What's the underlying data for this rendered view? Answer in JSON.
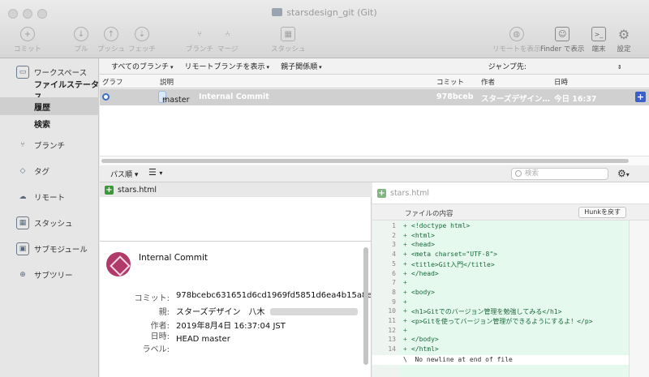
{
  "window": {
    "title": "starsdesign_git (Git)"
  },
  "toolbar": {
    "left": [
      {
        "label": "コミット",
        "icon": "plus-icon",
        "glyph": "+"
      },
      {
        "label": "プル",
        "icon": "arrow-down-icon",
        "glyph": "↓"
      },
      {
        "label": "プッシュ",
        "icon": "arrow-up-icon",
        "glyph": "↑"
      },
      {
        "label": "フェッチ",
        "icon": "fetch-icon",
        "glyph": "⇣"
      },
      {
        "label": "ブランチ",
        "icon": "branch-icon",
        "glyph": "⑂"
      },
      {
        "label": "マージ",
        "icon": "merge-icon",
        "glyph": "⑃"
      },
      {
        "label": "スタッシュ",
        "icon": "stash-icon",
        "glyph": "▦"
      }
    ],
    "right": [
      {
        "label": "リモートを表示",
        "icon": "globe-icon",
        "glyph": "◍"
      },
      {
        "label": "Finder で表示",
        "icon": "finder-icon",
        "glyph": "☺"
      },
      {
        "label": "端末",
        "icon": "terminal-icon",
        "glyph": ">_"
      },
      {
        "label": "設定",
        "icon": "gear-icon",
        "glyph": "⚙"
      }
    ]
  },
  "sidebar": {
    "workspace": "ワークスペース",
    "sub": [
      "ファイルステータス",
      "履歴",
      "検索"
    ],
    "items": [
      {
        "label": "ブランチ",
        "icon": "branch-icon",
        "glyph": "⑂"
      },
      {
        "label": "タグ",
        "icon": "tag-icon",
        "glyph": "◇"
      },
      {
        "label": "リモート",
        "icon": "cloud-icon",
        "glyph": "☁"
      },
      {
        "label": "スタッシュ",
        "icon": "stash-icon",
        "glyph": "▦"
      },
      {
        "label": "サブモジュール",
        "icon": "submodule-icon",
        "glyph": "▣"
      },
      {
        "label": "サブツリー",
        "icon": "subtree-icon",
        "glyph": "⊕"
      }
    ]
  },
  "filters": {
    "all_branches": "すべてのブランチ",
    "show_remote": "リモートブランチを表示",
    "ancestor_order": "親子関係順",
    "jump_to": "ジャンプ先:"
  },
  "columns": {
    "graph": "グラフ",
    "description": "説明",
    "commit": "コミット",
    "author": "作者",
    "date": "日時"
  },
  "commit_row": {
    "branch": "master",
    "message": "Internal Commit",
    "hash": "978bceb",
    "author": "スターズデザイン…",
    "date": "今日 16:37"
  },
  "bottom_bar": {
    "path_sort": "パス順",
    "search_placeholder": "検索"
  },
  "files": [
    {
      "name": "stars.html"
    }
  ],
  "details": {
    "message": "Internal Commit",
    "labels": {
      "commit": "コミット:",
      "parent": "親:",
      "author": "作者:",
      "date": "日時:",
      "label": "ラベル:"
    },
    "commit": "978bcebc631651d6cd1969fd5851d6ea4b15a8e6 |",
    "parent": "スターズデザイン　八木",
    "date": "2019年8月4日 16:37:04 JST",
    "labels_value": "HEAD master"
  },
  "diff": {
    "file": "stars.html",
    "content_label": "ファイルの内容",
    "hunk_button": "Hunkを戻す",
    "lines": [
      {
        "n": "1",
        "text": "<!doctype html>"
      },
      {
        "n": "2",
        "text": "<html>"
      },
      {
        "n": "3",
        "text": "<head>"
      },
      {
        "n": "4",
        "text": "<meta charset=\"UTF-8\">"
      },
      {
        "n": "5",
        "text": "<title>Git入門</title>"
      },
      {
        "n": "6",
        "text": "</head>"
      },
      {
        "n": "7",
        "text": ""
      },
      {
        "n": "8",
        "text": "<body>"
      },
      {
        "n": "9",
        "text": ""
      },
      {
        "n": "10",
        "text": "<h1>Gitでのバージョン管理を勉強してみる</h1>"
      },
      {
        "n": "11",
        "text": "<p>Gitを使ってバージョン管理ができるようにするよ！</p>"
      },
      {
        "n": "12",
        "text": ""
      },
      {
        "n": "13",
        "text": "</body>"
      },
      {
        "n": "14",
        "text": "</html>"
      }
    ],
    "no_newline": "\\  No newline at end of file"
  }
}
